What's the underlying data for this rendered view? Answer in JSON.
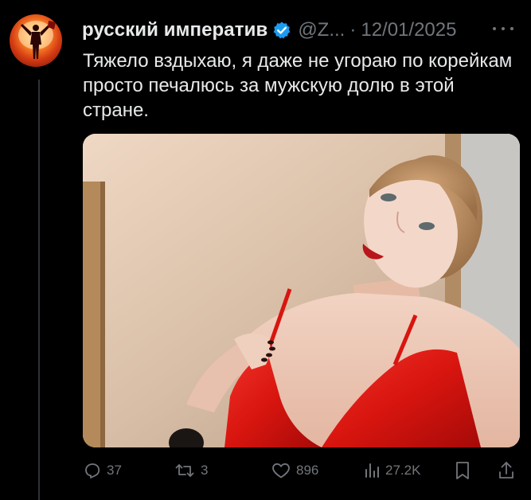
{
  "post": {
    "author": {
      "display_name": "русский императив",
      "handle": "@Z...",
      "verified": true,
      "avatar_icon": "avatar-figure-fire-icon"
    },
    "separator": "·",
    "date": "12/01/2025",
    "text": "Тяжело вздыхаю, я даже не угораю по корейкам просто печалюсь за мужскую долю в этой стране.",
    "media": {
      "type": "photo",
      "description_icon": "selfie-photo"
    },
    "actions": {
      "replies": "37",
      "reposts": "3",
      "likes": "896",
      "views": "27.2K"
    }
  },
  "colors": {
    "background": "#000000",
    "text_primary": "#e7e9ea",
    "text_secondary": "#71767b",
    "verified": "#1d9bf0",
    "divider": "#2f3336"
  }
}
